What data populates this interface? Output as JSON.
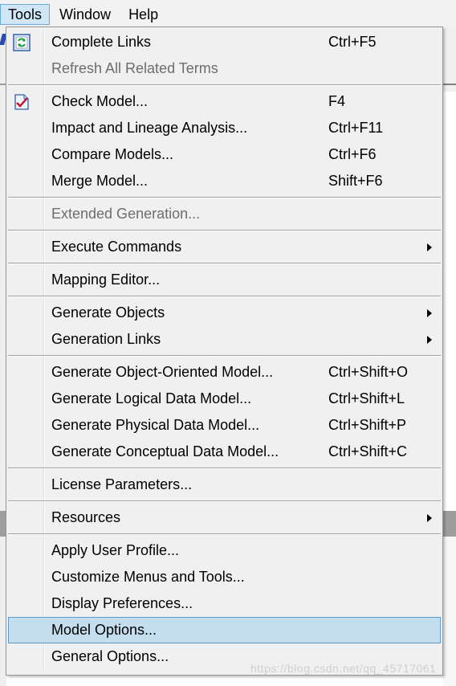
{
  "menubar": {
    "items": [
      {
        "label": "Tools",
        "active": true
      },
      {
        "label": "Window",
        "active": false
      },
      {
        "label": "Help",
        "active": false
      }
    ]
  },
  "menu": {
    "items": [
      {
        "label": "Complete Links",
        "shortcut": "Ctrl+F5",
        "icon": "complete-links-icon"
      },
      {
        "label": "Refresh All Related Terms",
        "shortcut": "",
        "disabled": true
      },
      {
        "label": "Check Model...",
        "shortcut": "F4",
        "icon": "check-model-icon"
      },
      {
        "label": "Impact and Lineage Analysis...",
        "shortcut": "Ctrl+F11"
      },
      {
        "label": "Compare Models...",
        "shortcut": "Ctrl+F6"
      },
      {
        "label": "Merge Model...",
        "shortcut": "Shift+F6"
      },
      {
        "label": "Extended Generation...",
        "shortcut": "",
        "disabled": true
      },
      {
        "label": "Execute Commands",
        "shortcut": "",
        "submenu": true
      },
      {
        "label": "Mapping Editor...",
        "shortcut": ""
      },
      {
        "label": "Generate Objects",
        "shortcut": "",
        "submenu": true
      },
      {
        "label": "Generation Links",
        "shortcut": "",
        "submenu": true
      },
      {
        "label": "Generate Object-Oriented Model...",
        "shortcut": "Ctrl+Shift+O"
      },
      {
        "label": "Generate Logical Data Model...",
        "shortcut": "Ctrl+Shift+L"
      },
      {
        "label": "Generate Physical Data Model...",
        "shortcut": "Ctrl+Shift+P"
      },
      {
        "label": "Generate Conceptual Data Model...",
        "shortcut": "Ctrl+Shift+C"
      },
      {
        "label": "License Parameters...",
        "shortcut": ""
      },
      {
        "label": "Resources",
        "shortcut": "",
        "submenu": true
      },
      {
        "label": "Apply User Profile...",
        "shortcut": ""
      },
      {
        "label": "Customize Menus and Tools...",
        "shortcut": ""
      },
      {
        "label": "Display Preferences...",
        "shortcut": ""
      },
      {
        "label": "Model Options...",
        "shortcut": "",
        "highlighted": true
      },
      {
        "label": "General Options...",
        "shortcut": ""
      }
    ]
  },
  "watermark": "https://blog.csdn.net/qq_45717061",
  "colors": {
    "menu_bg": "#f0f0f0",
    "highlight_bg": "#c4deef",
    "highlight_border": "#5a9bd0",
    "disabled_text": "#6d6d6d"
  }
}
